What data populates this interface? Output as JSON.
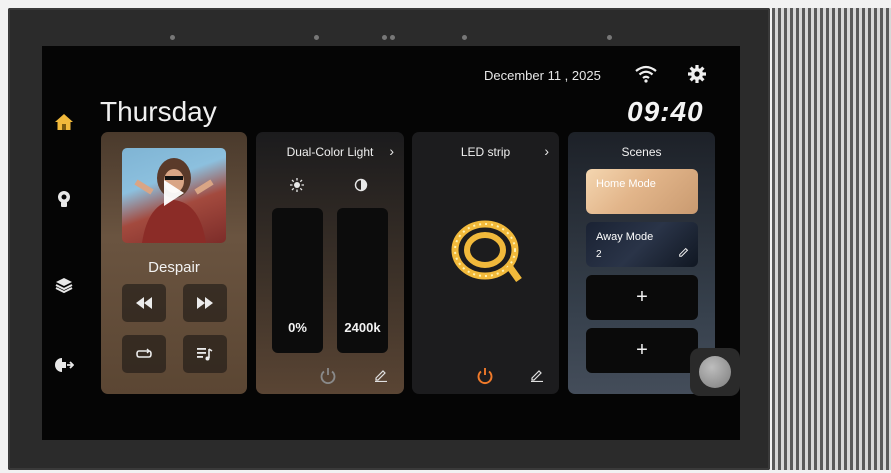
{
  "header": {
    "date": "December 11 , 2025",
    "day": "Thursday",
    "time": "09:40"
  },
  "sidebar": {
    "items": [
      {
        "icon": "home-icon",
        "active": true
      },
      {
        "icon": "lightbulb-icon",
        "active": false
      },
      {
        "icon": "layers-icon",
        "active": false
      },
      {
        "icon": "exit-icon",
        "active": false
      }
    ]
  },
  "music": {
    "song": "Despair",
    "controls": [
      "previous-icon",
      "next-icon",
      "repeat-icon",
      "playlist-icon"
    ]
  },
  "dual_color_light": {
    "title": "Dual-Color Light",
    "chevron": "›",
    "brightness": "0%",
    "color_temp": "2400k"
  },
  "led_strip": {
    "title": "LED strip",
    "chevron": "›"
  },
  "scenes": {
    "title": "Scenes",
    "items": [
      {
        "label": "Home Mode"
      },
      {
        "label": "Away Mode",
        "count": "2"
      }
    ],
    "add_label": "+"
  },
  "colors": {
    "accent": "#f1b93b",
    "power_on": "#f07a2a",
    "power_off": "#8a8a8a"
  }
}
